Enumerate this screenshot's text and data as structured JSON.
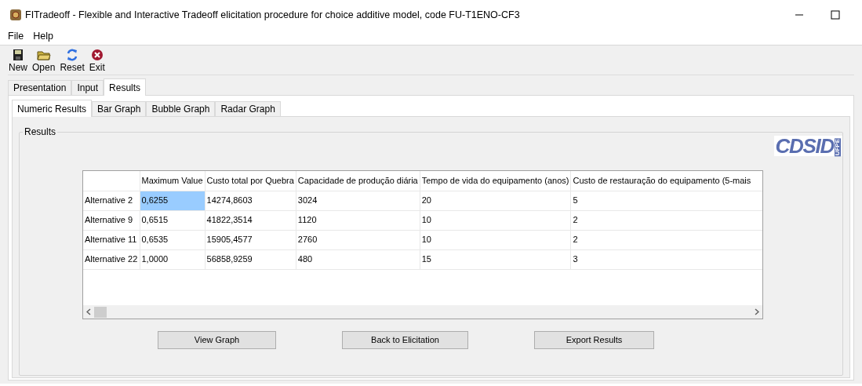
{
  "window": {
    "title": "FITradeoff - Flexible and Interactive Tradeoff elicitation  procedure for choice additive model, code FU-T1ENO-CF3"
  },
  "menu": [
    "File",
    "Help"
  ],
  "toolbar": [
    {
      "kind": "new",
      "label": "New"
    },
    {
      "kind": "open",
      "label": "Open"
    },
    {
      "kind": "reset",
      "label": "Reset"
    },
    {
      "kind": "exit",
      "label": "Exit"
    }
  ],
  "tabs": [
    {
      "label": "Presentation",
      "selected": false
    },
    {
      "label": "Input",
      "selected": false
    },
    {
      "label": "Results",
      "selected": true
    }
  ],
  "subtabs": [
    {
      "label": "Numeric Results",
      "selected": true
    },
    {
      "label": "Bar Graph",
      "selected": false
    },
    {
      "label": "Bubble Graph",
      "selected": false
    },
    {
      "label": "Radar Graph",
      "selected": false
    }
  ],
  "group_title": "Results",
  "logo": {
    "text": "CDSID",
    "side": "UFPE"
  },
  "table": {
    "columns": [
      "Maximum Value",
      "Custo total por Quebra",
      "Capacidade de produção diária",
      "Tempo de vida do equipamento (anos)",
      "Custo de restauração do equipamento (5-mais"
    ],
    "rows": [
      {
        "label": "Alternative 2",
        "cells": [
          {
            "text": "0,6255",
            "selected": true
          },
          {
            "text": "14274,8603",
            "selected": false
          },
          {
            "text": "3024",
            "selected": false
          },
          {
            "text": "20",
            "selected": false
          },
          {
            "text": "5",
            "selected": false
          }
        ]
      },
      {
        "label": "Alternative 9",
        "cells": [
          {
            "text": "0,6515",
            "selected": false
          },
          {
            "text": "41822,3514",
            "selected": false
          },
          {
            "text": "1120",
            "selected": false
          },
          {
            "text": "10",
            "selected": false
          },
          {
            "text": "2",
            "selected": false
          }
        ]
      },
      {
        "label": "Alternative 11",
        "cells": [
          {
            "text": "0,6535",
            "selected": false
          },
          {
            "text": "15905,4577",
            "selected": false
          },
          {
            "text": "2760",
            "selected": false
          },
          {
            "text": "10",
            "selected": false
          },
          {
            "text": "2",
            "selected": false
          }
        ]
      },
      {
        "label": "Alternative 22",
        "cells": [
          {
            "text": "1,0000",
            "selected": false
          },
          {
            "text": "56858,9259",
            "selected": false
          },
          {
            "text": "480",
            "selected": false
          },
          {
            "text": "15",
            "selected": false
          },
          {
            "text": "3",
            "selected": false
          }
        ]
      }
    ]
  },
  "buttons": [
    "View Graph",
    "Back to Elicitation",
    "Export Results"
  ]
}
